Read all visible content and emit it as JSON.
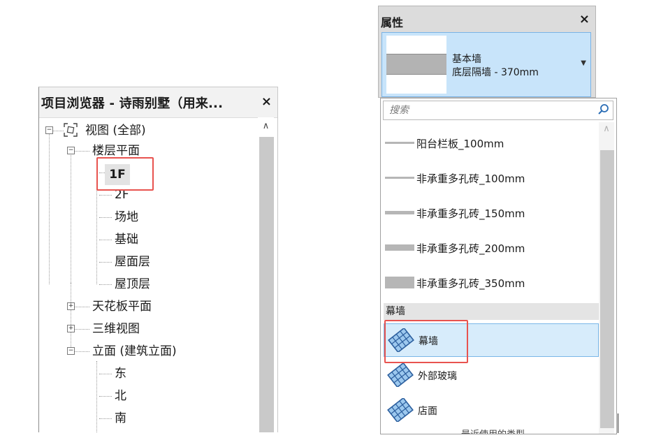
{
  "project_browser": {
    "title": "项目浏览器 - 诗雨别墅（用来...",
    "close": "×",
    "tree": {
      "views": "视图 (全部)",
      "floor_plans": "楼层平面",
      "floor_items": [
        "1F",
        "2F",
        "场地",
        "基础",
        "屋面层",
        "屋顶层"
      ],
      "ceiling_plans": "天花板平面",
      "3d_views": "三维视图",
      "elevations": "立面 (建筑立面)",
      "elevation_items": [
        "东",
        "北",
        "南"
      ]
    }
  },
  "properties": {
    "title": "属性",
    "close": "×",
    "type_family": "基本墙",
    "type_name": "底层隔墙 - 370mm",
    "search_placeholder": "搜索",
    "wall_items": [
      "阳台栏板_100mm",
      "非承重多孔砖_100mm",
      "非承重多孔砖_150mm",
      "非承重多孔砖_200mm",
      "非承重多孔砖_350mm"
    ],
    "group_header": "幕墙",
    "curtain_items": [
      "幕墙",
      "外部玻璃",
      "店面"
    ],
    "cut_off_text": "最近使用的类型"
  },
  "colors": {
    "selection_blue": "#c8e4fa",
    "selection_border": "#79b3e6",
    "highlight_red": "#e8534f"
  }
}
